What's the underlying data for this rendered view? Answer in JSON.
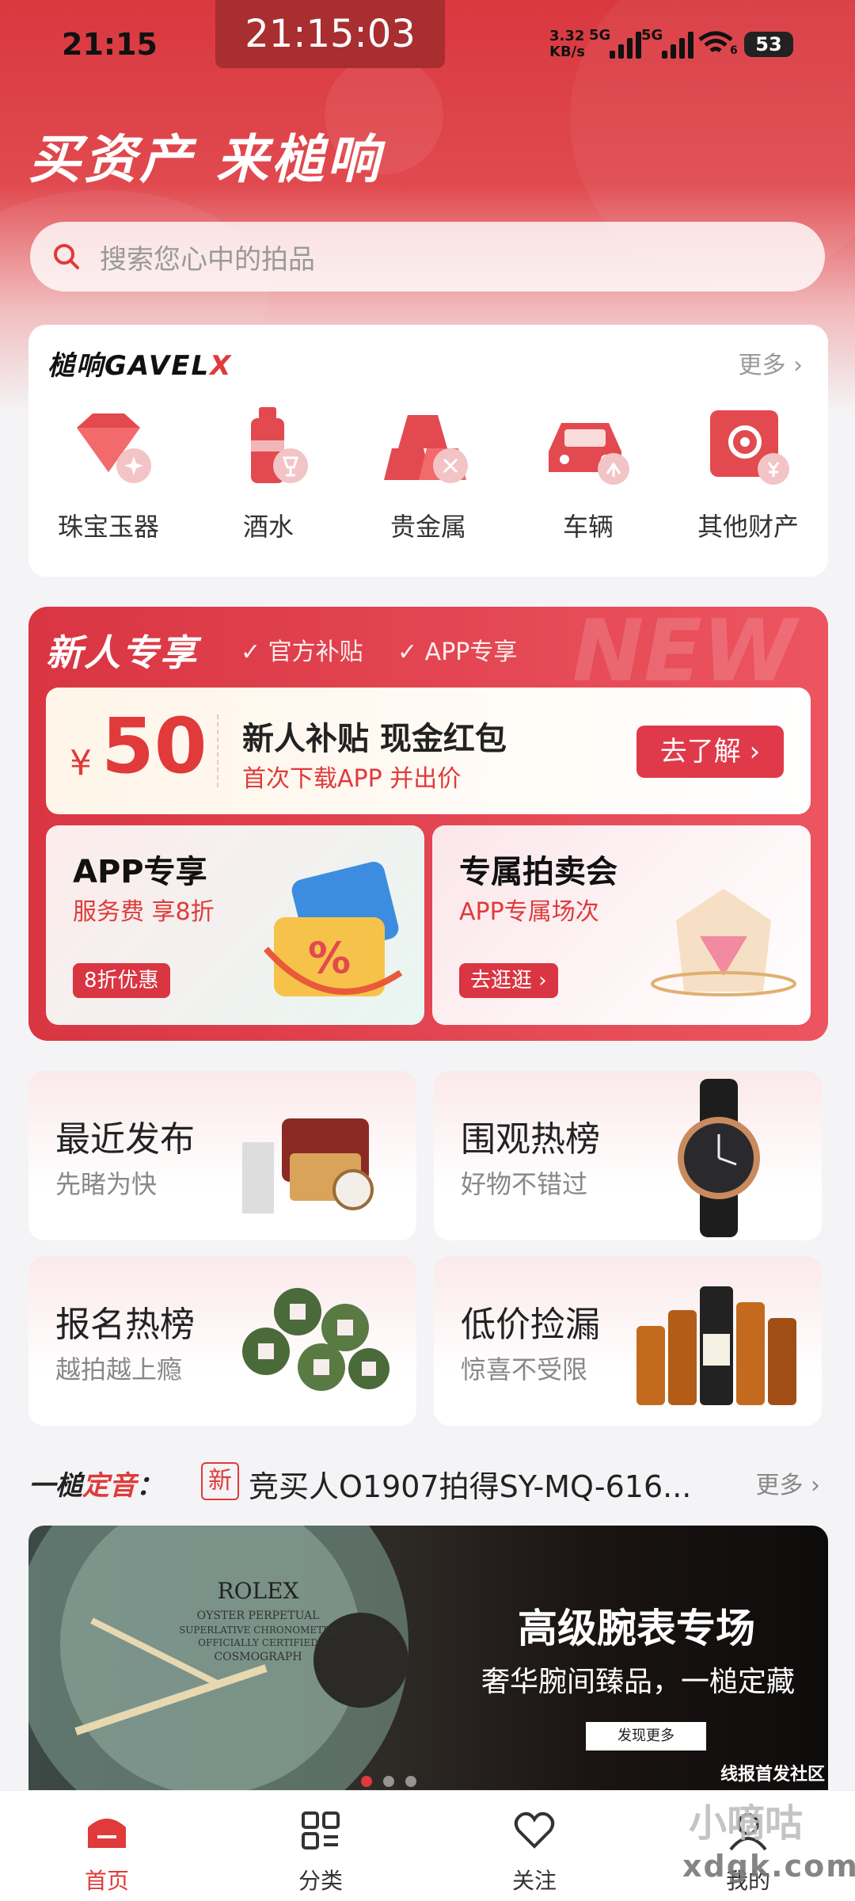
{
  "status_bar": {
    "time": "21:15",
    "clock_overlay": "21:15:03",
    "net_speed_line1": "3.32",
    "net_speed_line2": "KB/s",
    "sim1": "5G",
    "sim2": "5G",
    "wifi_label": "6",
    "battery": "53"
  },
  "header": {
    "slogan": "买资产 来槌响"
  },
  "search": {
    "placeholder": "搜索您心中的拍品"
  },
  "category_card": {
    "brand_prefix": "槌响",
    "brand_name": "GAVEL",
    "brand_suffix": "X",
    "more": "更多 ›",
    "items": [
      {
        "label": "珠宝玉器",
        "icon": "diamond-icon"
      },
      {
        "label": "酒水",
        "icon": "bottle-icon"
      },
      {
        "label": "贵金属",
        "icon": "gold-bar-icon"
      },
      {
        "label": "车辆",
        "icon": "car-icon"
      },
      {
        "label": "其他财产",
        "icon": "property-icon"
      }
    ]
  },
  "new_user": {
    "title": "新人专享",
    "watermark": "NEW",
    "tag1": "✓ 官方补贴",
    "tag2": "✓ APP专享",
    "coupon": {
      "currency": "¥",
      "amount": "50",
      "heading": "新人补贴 现金红包",
      "subtitle": "首次下载APP 并出价",
      "button": "去了解 ›"
    },
    "promos": [
      {
        "heading": "APP专享",
        "subtitle": "服务费 享8折",
        "button": "8折优惠"
      },
      {
        "heading": "专属拍卖会",
        "subtitle": "APP专属场次",
        "button": "去逛逛 ›"
      }
    ]
  },
  "tiles": [
    {
      "heading": "最近发布",
      "subtitle": "先睹为快"
    },
    {
      "heading": "围观热榜",
      "subtitle": "好物不错过"
    },
    {
      "heading": "报名热榜",
      "subtitle": "越拍越上瘾"
    },
    {
      "heading": "低价捡漏",
      "subtitle": "惊喜不受限"
    }
  ],
  "ticker": {
    "lead_prefix": "一槌",
    "lead_em": "定音",
    "lead_colon": "：",
    "badge": "新",
    "text": "竞买人O1907拍得SY-MQ-616...",
    "more": "更多 ›"
  },
  "banner": {
    "heading": "高级腕表专场",
    "subtitle": "奢华腕间臻品，一槌定藏",
    "button": "发现更多",
    "dial_brand": "ROLEX",
    "dial_line1": "OYSTER PERPETUAL",
    "dial_line2": "SUPERLATIVE CHRONOMETER",
    "dial_line3": "OFFICIALLY CERTIFIED",
    "dial_line4": "COSMOGRAPH",
    "watermark": "线报首发社区"
  },
  "tabbar": [
    {
      "label": "首页",
      "icon": "home-icon",
      "active": true
    },
    {
      "label": "分类",
      "icon": "grid-icon",
      "active": false
    },
    {
      "label": "关注",
      "icon": "heart-icon",
      "active": false
    },
    {
      "label": "我的",
      "icon": "profile-icon",
      "active": false
    }
  ],
  "site_watermark": {
    "line1": "小嘀咕",
    "line2": "xdgk.com"
  },
  "colors": {
    "brand_red": "#e03a3a",
    "hero_red": "#d9383f"
  }
}
